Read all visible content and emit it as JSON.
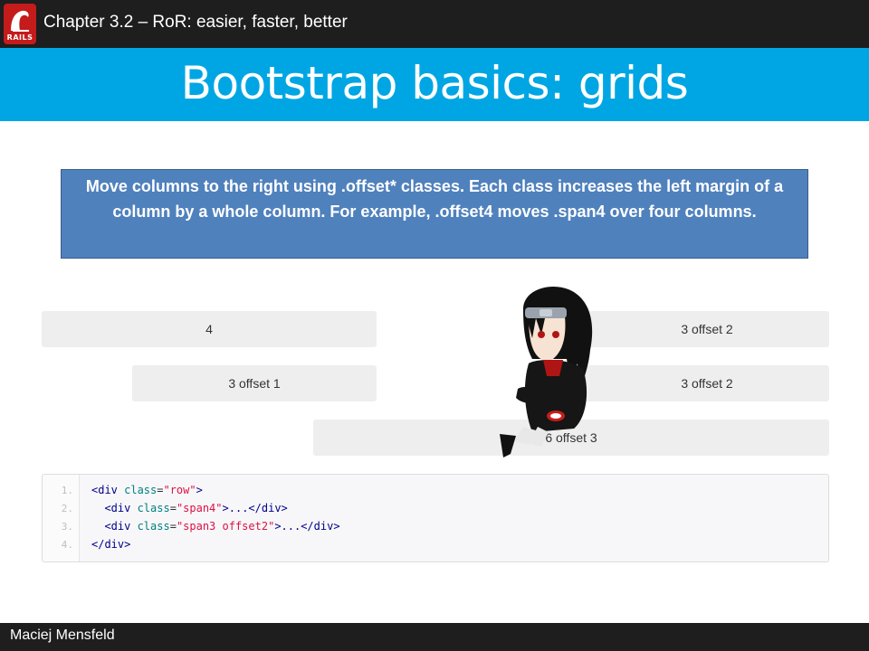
{
  "header": {
    "logo_text": "RAILS",
    "chapter": "Chapter 3.2 – RoR: easier, faster, better"
  },
  "title": "Bootstrap basics: grids",
  "callout": {
    "text": "Move columns to the right using .offset* classes. Each class increases the left margin of a column by a whole column. For example, .offset4 moves .span4 over four columns."
  },
  "grid": {
    "row1": {
      "left": "4",
      "right": "3 offset 2"
    },
    "row2": {
      "left": "3 offset 1",
      "right": "3 offset 2"
    },
    "row3": {
      "single": "6 offset 3"
    }
  },
  "code": {
    "line_numbers": [
      "1.",
      "2.",
      "3.",
      "4."
    ],
    "lines": [
      {
        "open": "<div ",
        "attr": "class",
        "eq": "=",
        "val": "\"row\"",
        "close": ">"
      },
      {
        "open": "  <div ",
        "attr": "class",
        "eq": "=",
        "val": "\"span4\"",
        "close": ">...</div>"
      },
      {
        "open": "  <div ",
        "attr": "class",
        "eq": "=",
        "val": "\"span3 offset2\"",
        "close": ">...</div>"
      },
      {
        "open": "</div>",
        "attr": "",
        "eq": "",
        "val": "",
        "close": ""
      }
    ]
  },
  "footer": {
    "author": "Maciej Mensfeld"
  },
  "colors": {
    "header_bg": "#1e1e1e",
    "title_bg": "#00a6e3",
    "callout_bg": "#4f81bd",
    "logo_red": "#c41b1b"
  }
}
